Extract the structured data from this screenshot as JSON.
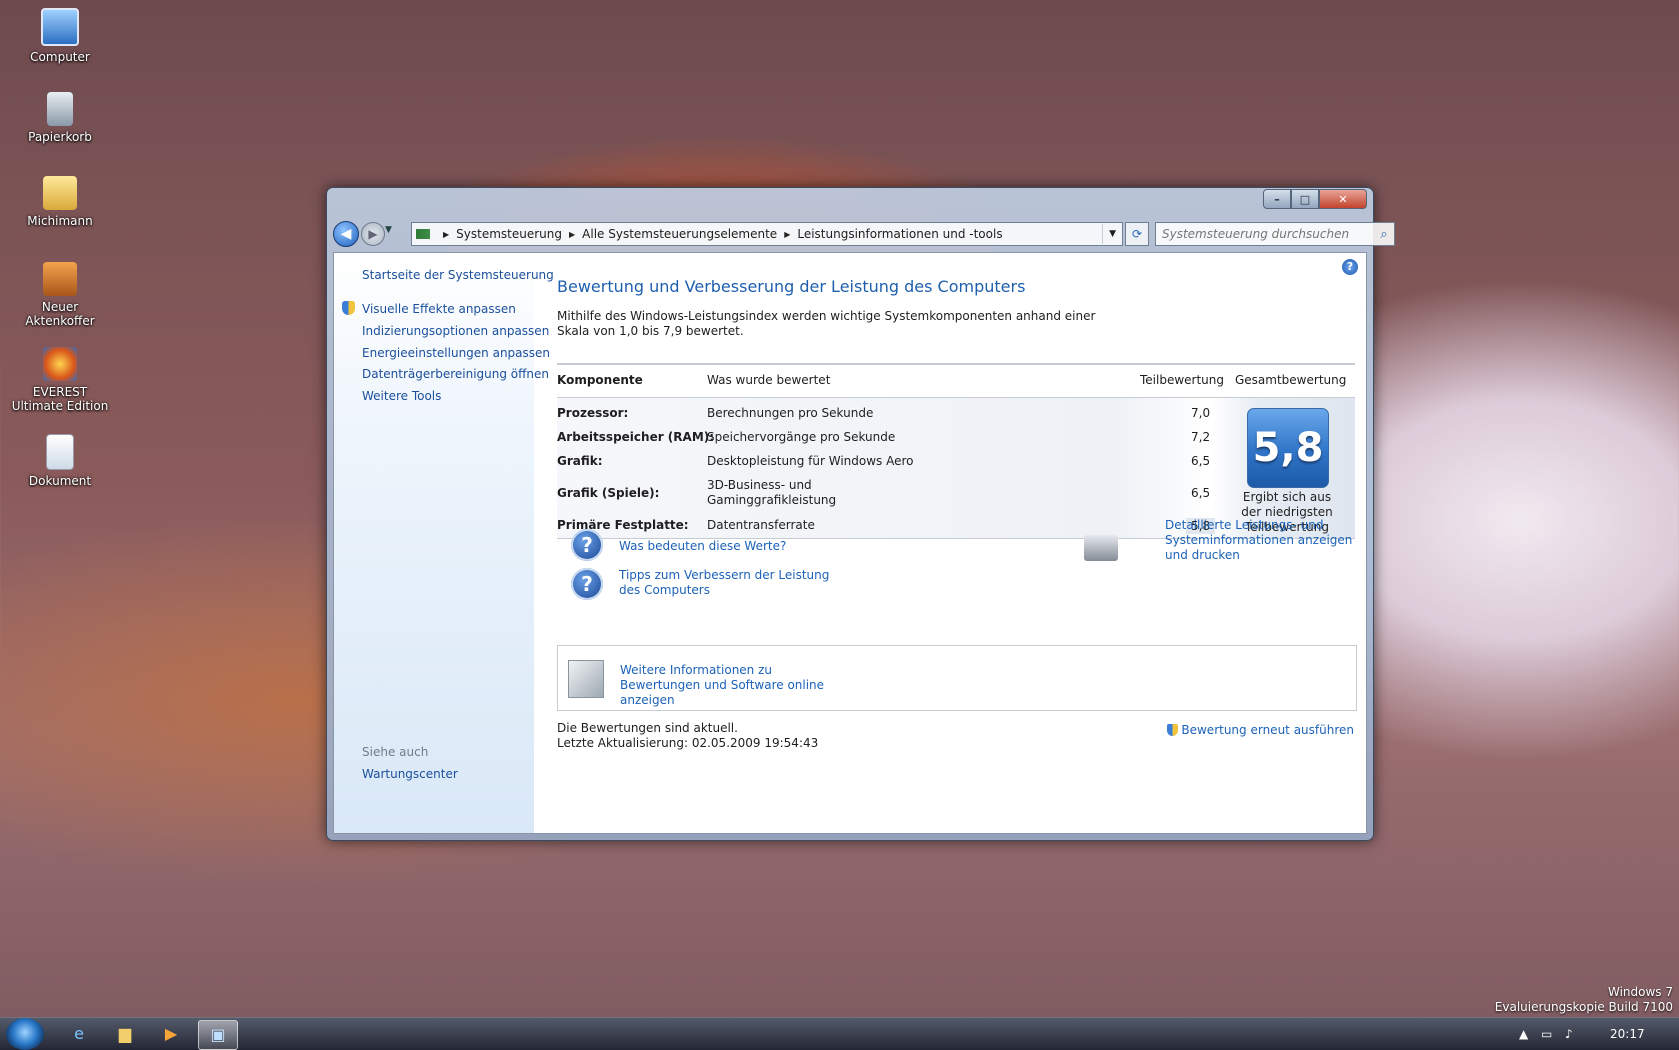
{
  "desktop": {
    "icons": [
      "Computer",
      "Papierkorb",
      "Michimann",
      "Neuer Aktenkoffer",
      "EVEREST Ultimate Edition",
      "Dokument"
    ]
  },
  "window": {
    "address": {
      "crumbs": [
        "Systemsteuerung",
        "Alle Systemsteuerungselemente",
        "Leistungsinformationen und -tools"
      ]
    },
    "search_placeholder": "Systemsteuerung durchsuchen",
    "sidebar": {
      "home": "Startseite der Systemsteuerung",
      "links": [
        "Visuelle Effekte anpassen",
        "Indizierungsoptionen anpassen",
        "Energieeinstellungen anpassen",
        "Datenträgerbereinigung öffnen",
        "Weitere Tools"
      ],
      "see_also": "Siehe auch",
      "see_also_links": [
        "Wartungscenter"
      ]
    },
    "main": {
      "title": "Bewertung und Verbesserung der Leistung des Computers",
      "intro": "Mithilfe des Windows-Leistungsindex werden wichtige Systemkomponenten anhand einer Skala von 1,0 bis 7,9 bewertet.",
      "table": {
        "headers": [
          "Komponente",
          "Was wurde bewertet",
          "Teilbewertung",
          "Gesamtbewertung"
        ],
        "rows": [
          {
            "component": "Prozessor:",
            "rated": "Berechnungen pro Sekunde",
            "score": "7,0"
          },
          {
            "component": "Arbeitsspeicher (RAM):",
            "rated": "Speichervorgänge pro Sekunde",
            "score": "7,2"
          },
          {
            "component": "Grafik:",
            "rated": "Desktopleistung für Windows Aero",
            "score": "6,5"
          },
          {
            "component": "Grafik (Spiele):",
            "rated": "3D-Business- und Gaminggrafikleistung",
            "score": "6,5"
          },
          {
            "component": "Primäre Festplatte:",
            "rated": "Datentransferrate",
            "score": "5,8"
          }
        ],
        "base_score": "5,8",
        "base_score_note": "Ergibt sich aus der niedrigsten Teilbewertung"
      },
      "links": {
        "what_mean": "Was bedeuten diese Werte?",
        "tips": "Tipps zum Verbessern der Leistung des Computers",
        "details": "Detaillierte Leistungs- und Systeminformationen anzeigen und drucken",
        "online": "Weitere Informationen zu Bewertungen und Software online anzeigen",
        "rerun": "Bewertung erneut ausführen"
      },
      "status": {
        "current": "Die Bewertungen sind aktuell.",
        "last_update": "Letzte Aktualisierung: 02.05.2009 19:54:43"
      }
    }
  },
  "taskbar": {
    "clock": "20:17"
  },
  "watermark": {
    "line1": "Windows 7",
    "line2": "Evaluierungskopie Build 7100"
  }
}
